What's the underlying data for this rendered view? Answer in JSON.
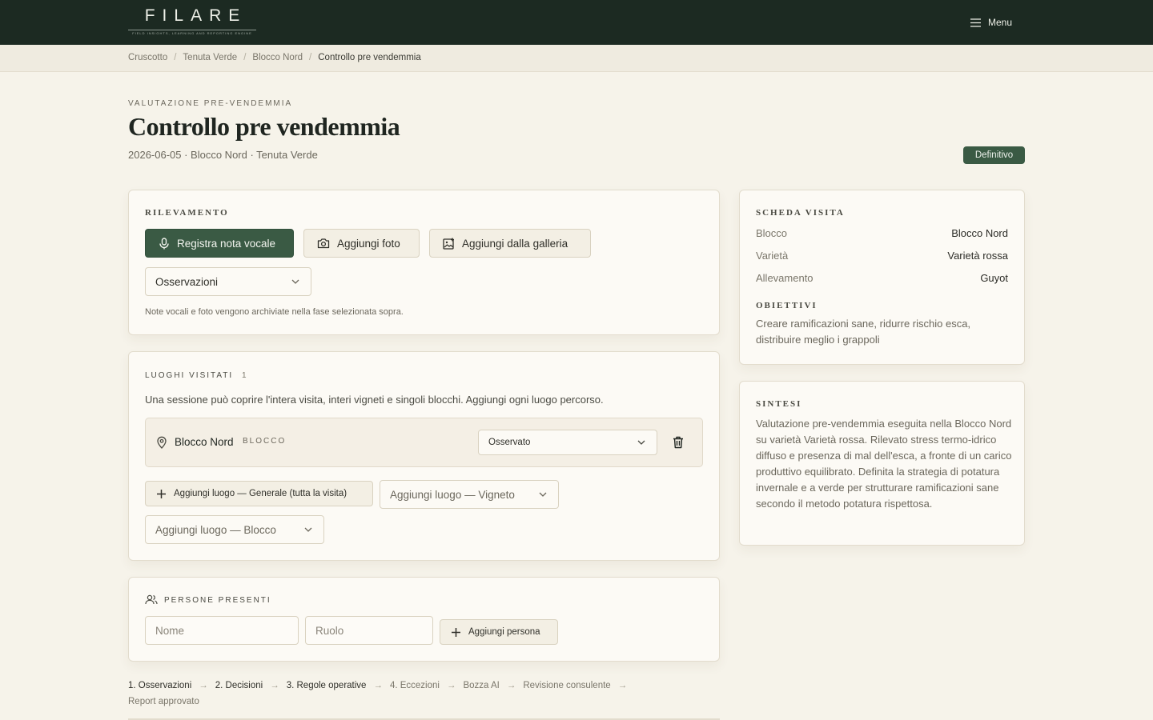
{
  "brand": {
    "name": "FILARE",
    "tagline": "FIELD INSIGHTS, LEARNING AND REPORTING ENGINE"
  },
  "nav": {
    "menu_label": "Menu"
  },
  "breadcrumb": [
    "Cruscotto",
    "Tenuta Verde",
    "Blocco Nord",
    "Controllo pre vendemmia"
  ],
  "header": {
    "eyebrow": "VALUTAZIONE PRE-VENDEMMIA",
    "title": "Controllo pre vendemmia",
    "meta": "2026-06-05 · Blocco Nord · Tenuta Verde",
    "status_badge": "Definitivo"
  },
  "rilevamento": {
    "heading": "RILEVAMENTO",
    "record_voice": "Registra nota vocale",
    "add_photo": "Aggiungi foto",
    "add_gallery": "Aggiungi dalla galleria",
    "phase_select": "Osservazioni",
    "hint": "Note vocali e foto vengono archiviate nella fase selezionata sopra."
  },
  "luoghi": {
    "heading": "LUOGHI VISITATI",
    "count": "1",
    "description": "Una sessione può coprire l'intera visita, interi vigneti e singoli blocchi. Aggiungi ogni luogo percorso.",
    "places": [
      {
        "name": "Blocco Nord",
        "type": "BLOCCO",
        "status": "Osservato"
      }
    ],
    "add_general": "Aggiungi luogo — Generale (tutta la visita)",
    "add_vineyard": "Aggiungi luogo — Vigneto",
    "add_block": "Aggiungi luogo — Blocco"
  },
  "persone": {
    "heading": "PERSONE PRESENTI",
    "name_placeholder": "Nome",
    "role_placeholder": "Ruolo",
    "add_button": "Aggiungi persona"
  },
  "scheda": {
    "heading": "SCHEDA VISITA",
    "rows": [
      {
        "key": "Blocco",
        "value": "Blocco Nord"
      },
      {
        "key": "Varietà",
        "value": "Varietà rossa"
      },
      {
        "key": "Allevamento",
        "value": "Guyot"
      }
    ],
    "objectives_heading": "OBIETTIVI",
    "objectives": "Creare ramificazioni sane, ridurre rischio esca, distribuire meglio i grappoli"
  },
  "sintesi": {
    "heading": "SINTESI",
    "text": "Valutazione pre-vendemmia eseguita nella Blocco Nord su varietà Varietà rossa. Rilevato stress termo-idrico diffuso e presenza di mal dell'esca, a fronte di un carico produttivo equilibrato. Definita la strategia di potatura invernale e a verde per strutturare ramificazioni sane secondo il metodo potatura rispettosa."
  },
  "steps": [
    "1. Osservazioni",
    "2. Decisioni",
    "3. Regole operative",
    "4. Eccezioni",
    "Bozza AI",
    "Revisione consulente",
    "Report approvato"
  ],
  "colors": {
    "topbar": "#1c2a22",
    "accent": "#3a5a44",
    "background": "#f6f3ea"
  }
}
